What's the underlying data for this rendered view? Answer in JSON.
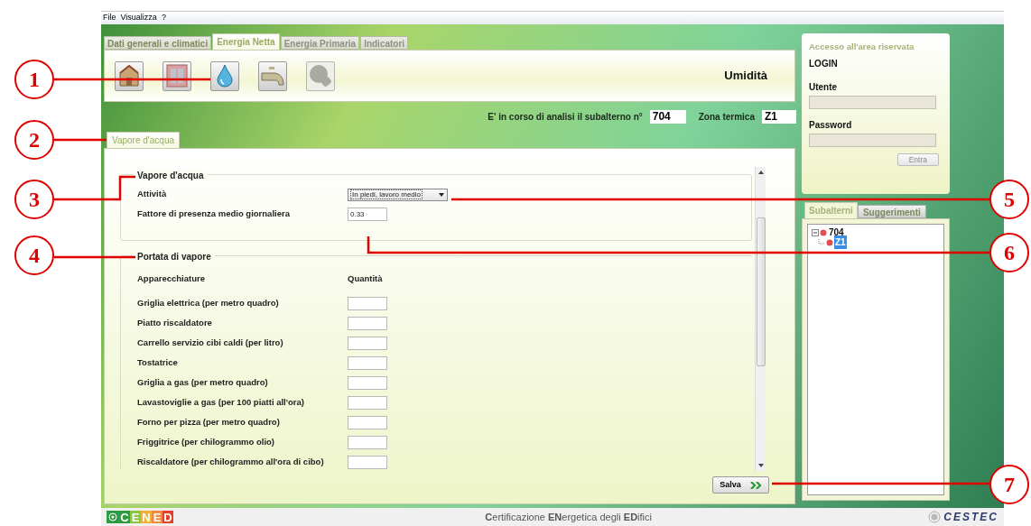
{
  "menu": [
    "File",
    "Visualizza",
    "?"
  ],
  "main_tabs": [
    {
      "label": "Dati generali e climatici",
      "selected": false,
      "disabled": false
    },
    {
      "label": "Energia Netta",
      "selected": true,
      "disabled": false
    },
    {
      "label": "Energia Primaria",
      "selected": false,
      "disabled": true
    },
    {
      "label": "Indicatori",
      "selected": false,
      "disabled": true
    }
  ],
  "toolbar": {
    "buttons": [
      {
        "kind": "house",
        "disabled": false
      },
      {
        "kind": "window",
        "disabled": false
      },
      {
        "kind": "drop",
        "disabled": false
      },
      {
        "kind": "tap",
        "disabled": false
      },
      {
        "kind": "bulb",
        "disabled": true
      }
    ],
    "title": "Umidità"
  },
  "analysis": {
    "label": "E' in corso di analisi il subalterno n°",
    "subalterno": "704",
    "zone_label": "Zona termica",
    "zone": "Z1"
  },
  "sub_tabs": [
    {
      "label": "Vapore d'acqua",
      "selected": true
    }
  ],
  "vapore_section": {
    "legend": "Vapore d'acqua",
    "activity_label": "Attività",
    "activity_value": "In piedi, lavoro medio",
    "presence_label": "Fattore di presenza medio giornaliera",
    "presence_value": "0.33"
  },
  "portata_section": {
    "legend": "Portata di vapore",
    "columns": [
      "Apparecchiature",
      "Quantità"
    ],
    "rows": [
      "Griglia elettrica (per metro quadro)",
      "Piatto riscaldatore",
      "Carrello servizio cibi caldi (per litro)",
      "Tostatrice",
      "Griglia a gas (per metro quadro)",
      "Lavastoviglie a gas (per 100 piatti all'ora)",
      "Forno per pizza (per metro quadro)",
      "Friggitrice (per chilogrammo olio)",
      "Riscaldatore (per chilogrammo all'ora di cibo)"
    ]
  },
  "save_button": "Salva",
  "login": {
    "title": "Accesso all'area riservata",
    "heading": "LOGIN",
    "user_label": "Utente",
    "password_label": "Password",
    "button": "Entra"
  },
  "side_tabs": [
    {
      "label": "Subalterni",
      "selected": true
    },
    {
      "label": "Suggerimenti",
      "selected": false
    }
  ],
  "tree": [
    {
      "label": "704",
      "expanded": true,
      "selected": false,
      "children": [
        {
          "label": "Z1",
          "selected": true
        }
      ]
    }
  ],
  "footer": {
    "logo_letters": [
      {
        "char": "C",
        "color": "#2e9a44"
      },
      {
        "char": "E",
        "color": "#8cc63f"
      },
      {
        "char": "N",
        "color": "#f2b134"
      },
      {
        "char": "E",
        "color": "#ee8a3a"
      },
      {
        "char": "D",
        "color": "#e2412a"
      }
    ],
    "text": "**C**ertificazione **EN**ergetica degli **ED**ifici",
    "partner_logo": "CESTEC"
  },
  "callouts": [
    "1",
    "2",
    "3",
    "4",
    "5",
    "6",
    "7"
  ]
}
